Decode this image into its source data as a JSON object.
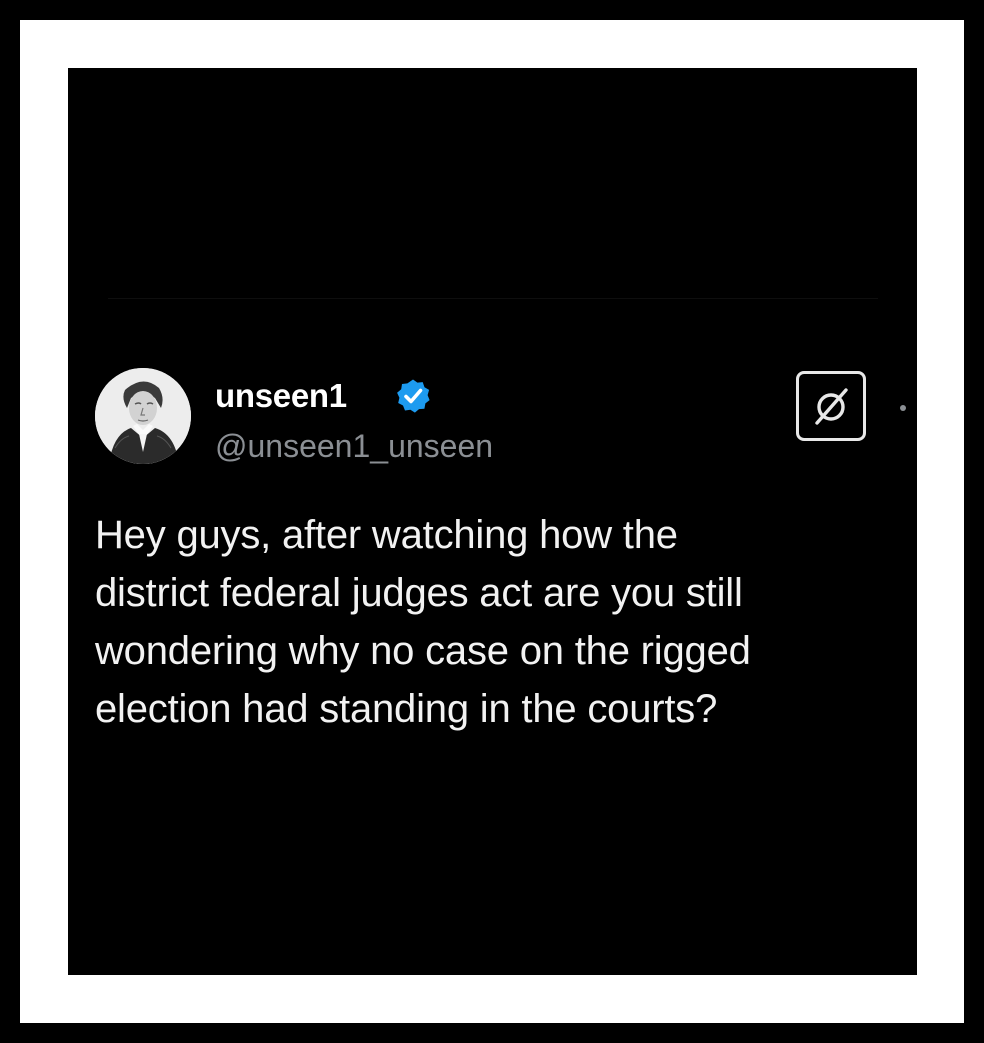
{
  "post": {
    "author": {
      "display_name": "unseen1",
      "handle": "@unseen1_unseen",
      "verified": true,
      "avatar_icon": "portrait-avatar"
    },
    "body": "Hey guys, after watching how the\ndistrict federal judges act are you still\nwondering why no case on the rigged\nelection had standing in the courts?",
    "actions": {
      "grok_icon": "grok-icon",
      "more_icon": "more-icon"
    }
  },
  "colors": {
    "background": "#000000",
    "frame": "#ffffff",
    "text_primary": "#f2f2f2",
    "text_secondary": "#8b8f94",
    "verified_badge": "#1d9bf0"
  }
}
